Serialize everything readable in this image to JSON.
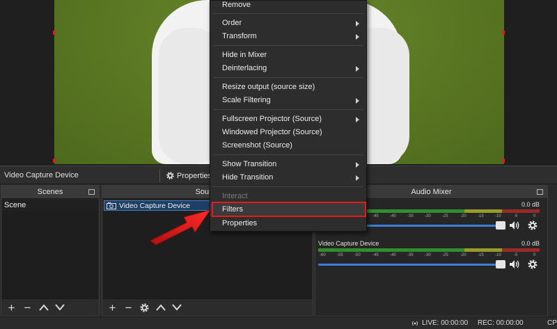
{
  "source_toolbar": {
    "source_name": "Video Capture Device",
    "properties_label": "Properties"
  },
  "docks": {
    "scenes": {
      "title": "Scenes",
      "items": [
        "Scene"
      ]
    },
    "sources": {
      "title": "Source",
      "items": [
        "Video Capture Device"
      ]
    },
    "audio_mixer": {
      "title": "Audio Mixer",
      "channels": [
        {
          "name": "",
          "db": "0.0 dB",
          "level": 0.93
        },
        {
          "name": "Video Capture Device",
          "db": "0.0 dB",
          "level": 0.93
        }
      ],
      "scale": [
        "-60",
        "-55",
        "-50",
        "-45",
        "-40",
        "-35",
        "-30",
        "-25",
        "-20",
        "-15",
        "-10",
        "-5",
        "0"
      ]
    }
  },
  "context_menu": {
    "items": [
      {
        "label": "Remove",
        "submenu": false
      },
      {
        "label": "Order",
        "submenu": true
      },
      {
        "label": "Transform",
        "submenu": true
      },
      {
        "label": "Hide in Mixer",
        "submenu": false
      },
      {
        "label": "Deinterlacing",
        "submenu": true
      },
      {
        "label": "Resize output (source size)",
        "submenu": false
      },
      {
        "label": "Scale Filtering",
        "submenu": true
      },
      {
        "label": "Fullscreen Projector (Source)",
        "submenu": true
      },
      {
        "label": "Windowed Projector (Source)",
        "submenu": false
      },
      {
        "label": "Screenshot (Source)",
        "submenu": false
      },
      {
        "label": "Show Transition",
        "submenu": true
      },
      {
        "label": "Hide Transition",
        "submenu": true
      },
      {
        "label": "Interact",
        "submenu": false,
        "disabled": true
      },
      {
        "label": "Filters",
        "submenu": false,
        "highlighted": true
      },
      {
        "label": "Properties",
        "submenu": false
      }
    ]
  },
  "status_bar": {
    "live": "LIVE: 00:00:00",
    "rec": "REC: 00:00:00",
    "cpu": "CP"
  },
  "colors": {
    "highlight_box": "#e31b1b",
    "arrow": "#e31b1b",
    "slider": "#3d7fd6",
    "selection": "#1d3f66"
  }
}
